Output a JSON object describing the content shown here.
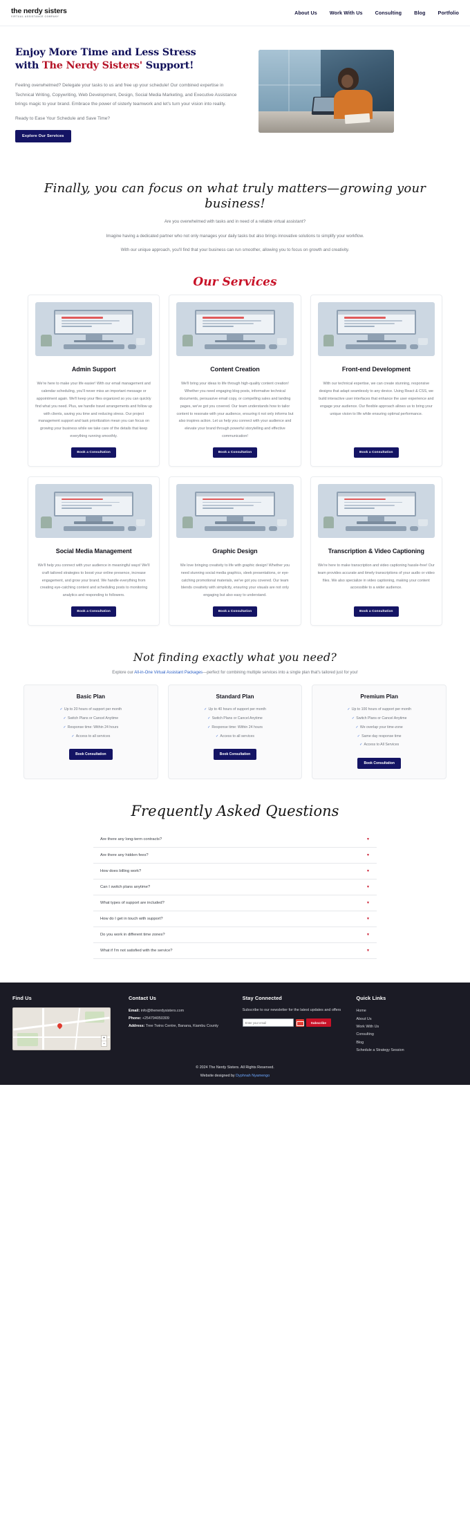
{
  "nav": {
    "logo_main": "the nerdy sisters",
    "logo_sub": "VIRTUAL ASSISTANCE COMPANY",
    "links": [
      {
        "label": "About Us"
      },
      {
        "label": "Work With Us"
      },
      {
        "label": "Consulting"
      },
      {
        "label": "Blog"
      },
      {
        "label": "Portfolio"
      }
    ]
  },
  "hero": {
    "title_line1": "Enjoy More Time and Less Stress",
    "title_line2_prefix": "with ",
    "title_line2_accent": "The Nerdy Sisters' ",
    "title_line2_suffix": "Support!",
    "paragraph": "Feeling overwhelmed? Delegate your tasks to us and free up your schedule! Our combined expertise in Technical Writing, Copywriting, Web Development, Design, Social Media Marketing, and Executive Assistance brings magic to your brand. Embrace the power of sisterly teamwork and let's turn your vision into reality.",
    "cta_line": "Ready to Ease Your Schedule and Save Time?",
    "button": "Explore Our Services",
    "image_alt": "woman-working-at-desk-photo"
  },
  "intro": {
    "heading": "Finally, you can focus on what truly matters—growing your business!",
    "p1": "Are you overwhelmed with tasks and in need of a reliable virtual assistant?",
    "p2": "Imagine having a dedicated partner who not only manages your daily tasks but also brings innovative solutions to simplify your workflow.",
    "p3": "With our unique approach, you'll find that your business can run smoother, allowing you to focus on growth and creativity."
  },
  "services": {
    "heading": "Our Services",
    "button_label": "Book a Consultation",
    "cards": [
      {
        "title": "Admin Support",
        "body": "We're here to make your life easier! With our email management and calendar scheduling, you'll never miss an important message or appointment again. We'll keep your files organized so you can quickly find what you need. Plus, we handle travel arrangements and follow up with clients, saving you time and reducing stress. Our project management support and task prioritization mean you can focus on growing your business while we take care of the details that keep everything running smoothly."
      },
      {
        "title": "Content Creation",
        "body": "We'll bring your ideas to life through high-quality content creation! Whether you need engaging blog posts, informative technical documents, persuasive email copy, or compelling sales and landing pages, we've got you covered. Our team understands how to tailor content to resonate with your audience, ensuring it not only informs but also inspires action. Let us help you connect with your audience and elevate your brand through powerful storytelling and effective communication!"
      },
      {
        "title": "Front-end Development",
        "body": "With our technical expertise, we can create stunning, responsive designs that adapt seamlessly to any device. Using React & CSS, we build interactive user interfaces that enhance the user experience and engage your audience. Our flexible approach allows us to bring your unique vision to life while ensuring optimal performance."
      },
      {
        "title": "Social Media Management",
        "body": "We'll help you connect with your audience in meaningful ways! We'll craft tailored strategies to boost your online presence, increase engagement, and grow your brand. We handle everything from creating eye-catching content and scheduling posts to monitoring analytics and responding to followers."
      },
      {
        "title": "Graphic Design",
        "body": "We love bringing creativity to life with graphic design! Whether you need stunning social media graphics, sleek presentations, or eye-catching promotional materials, we've got you covered. Our team blends creativity with simplicity, ensuring your visuals are not only engaging but also easy to understand."
      },
      {
        "title": "Transcription & Video Captioning",
        "body": "We're here to make transcription and video captioning hassle-free! Our team provides accurate and timely transcriptions of your audio or video files. We also specialize in video captioning, making your content accessible to a wider audience."
      }
    ]
  },
  "notfinding": {
    "heading": "Not finding exactly what you need?",
    "text_before": "Explore our ",
    "link": "All-in-One Virtual Assistant Packages",
    "text_after": "—perfect for combining multiple services into a single plan that's tailored just for you!"
  },
  "plans": {
    "button_label": "Book Consultation",
    "items": [
      {
        "title": "Basic Plan",
        "features": [
          "Up to 20 hours of support per month",
          "Switch Plans or Cancel Anytime",
          "Response time: Within 24 hours",
          "Access to all services"
        ]
      },
      {
        "title": "Standard Plan",
        "features": [
          "Up to 40 hours of support per month",
          "Switch Plans or Cancel Anytime",
          "Response time: Within 24 hours",
          "Access to all services"
        ]
      },
      {
        "title": "Premium Plan",
        "features": [
          "Up to 100 hours of support per month",
          "Switch Plans or Cancel Anytime",
          "We overlap your time-zone",
          "Same day response time",
          "Access to All Services"
        ]
      }
    ]
  },
  "faq": {
    "heading": "Frequently Asked Questions",
    "items": [
      {
        "question": "Are there any long-term contracts?"
      },
      {
        "question": "Are there any hidden fees?"
      },
      {
        "question": "How does billing work?"
      },
      {
        "question": "Can I switch plans anytime?"
      },
      {
        "question": "What types of support are included?"
      },
      {
        "question": "How do I get in touch with support?"
      },
      {
        "question": "Do you work in different time zones?"
      },
      {
        "question": "What if I'm not satisfied with the service?"
      }
    ]
  },
  "footer": {
    "find_us_title": "Find Us",
    "contact_title": "Contact Us",
    "contact_email_label": "Email:",
    "contact_email": "info@thenerdysisters.com",
    "contact_phone_label": "Phone:",
    "contact_phone": "+254794050309",
    "contact_address_label": "Address:",
    "contact_address": "Tree Twins Centre, Banana, Kiambu County",
    "stay_connected_title": "Stay Connected",
    "newsletter_text": "Subscribe to our newsletter for the latest updates and offers",
    "newsletter_placeholder": "Enter your email",
    "subscribe_button": "Subscribe",
    "quick_links_title": "Quick Links",
    "quick_links": [
      {
        "label": "Home"
      },
      {
        "label": "About Us"
      },
      {
        "label": "Work With Us"
      },
      {
        "label": "Consulting"
      },
      {
        "label": "Blog"
      },
      {
        "label": "Schedule a Strategy Session"
      }
    ],
    "copyright": "© 2024 The Nerdy Sisters. All Rights Reserved.",
    "credit_prefix": "Website designed by ",
    "credit_name": "Dyphnah Nyamengo"
  },
  "colors": {
    "navy": "#141464",
    "red": "#c81228",
    "footer_bg": "#1b1b25"
  }
}
